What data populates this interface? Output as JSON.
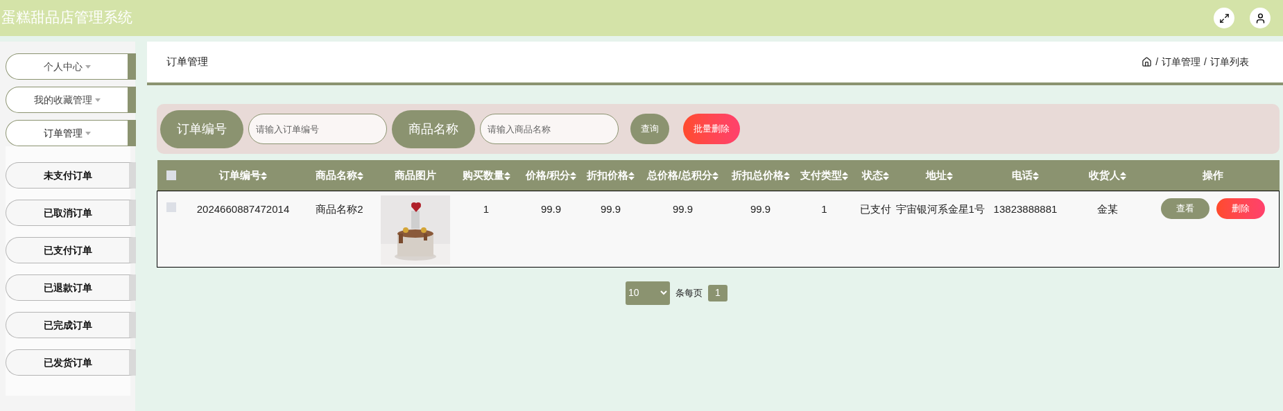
{
  "header": {
    "title": "蛋糕甜品店管理系统"
  },
  "sidebar": {
    "items": [
      {
        "label": "个人中心",
        "expanded": false
      },
      {
        "label": "我的收藏管理",
        "expanded": false
      },
      {
        "label": "订单管理",
        "expanded": true,
        "children": [
          {
            "label": "未支付订单"
          },
          {
            "label": "已取消订单"
          },
          {
            "label": "已支付订单"
          },
          {
            "label": "已退款订单"
          },
          {
            "label": "已完成订单"
          },
          {
            "label": "已发货订单"
          }
        ]
      }
    ]
  },
  "page": {
    "title": "订单管理",
    "breadcrumb": {
      "separator": "/",
      "items": [
        "订单管理",
        "订单列表"
      ]
    }
  },
  "search": {
    "fields": [
      {
        "label": "订单编号",
        "placeholder": "请输入订单编号"
      },
      {
        "label": "商品名称",
        "placeholder": "请输入商品名称"
      }
    ],
    "buttons": [
      {
        "label": "查询",
        "kind": "primary"
      },
      {
        "label": "批量删除",
        "kind": "danger"
      }
    ]
  },
  "table": {
    "select_all": {
      "checked": false
    },
    "columns": [
      {
        "label": "订单编号",
        "sortable": true
      },
      {
        "label": "商品名称",
        "sortable": true
      },
      {
        "label": "商品图片",
        "sortable": false
      },
      {
        "label": "购买数量",
        "sortable": true
      },
      {
        "label": "价格/积分",
        "sortable": true
      },
      {
        "label": "折扣价格",
        "sortable": true
      },
      {
        "label": "总价格/总积分",
        "sortable": true
      },
      {
        "label": "折扣总价格",
        "sortable": true
      },
      {
        "label": "支付类型",
        "sortable": true
      },
      {
        "label": "状态",
        "sortable": true
      },
      {
        "label": "地址",
        "sortable": true
      },
      {
        "label": "电话",
        "sortable": true
      },
      {
        "label": "收货人",
        "sortable": true
      },
      {
        "label": "操作",
        "sortable": false
      }
    ],
    "rows": [
      {
        "checked": false,
        "cells": [
          {
            "kind": "text",
            "text": "2024660887472014"
          },
          {
            "kind": "text",
            "text": "商品名称2"
          },
          {
            "kind": "picture"
          },
          {
            "kind": "text",
            "text": "1"
          },
          {
            "kind": "text",
            "text": "99.9"
          },
          {
            "kind": "text",
            "text": "99.9"
          },
          {
            "kind": "text",
            "text": "99.9"
          },
          {
            "kind": "text",
            "text": "99.9"
          },
          {
            "kind": "text",
            "text": "1"
          },
          {
            "kind": "text",
            "text": "已支付"
          },
          {
            "kind": "text",
            "text": "宇宙银河系金星1号"
          },
          {
            "kind": "text",
            "text": "13823888881"
          },
          {
            "kind": "text",
            "text": "金某"
          },
          {
            "kind": "actions",
            "buttons": [
              {
                "label": "查看",
                "kind": "primary"
              },
              {
                "label": "删除",
                "kind": "danger"
              }
            ]
          }
        ]
      }
    ]
  },
  "pagination": {
    "page_size": "10",
    "per_page_label": "条每页",
    "pages": [
      {
        "label": "1",
        "selected": true
      }
    ]
  }
}
